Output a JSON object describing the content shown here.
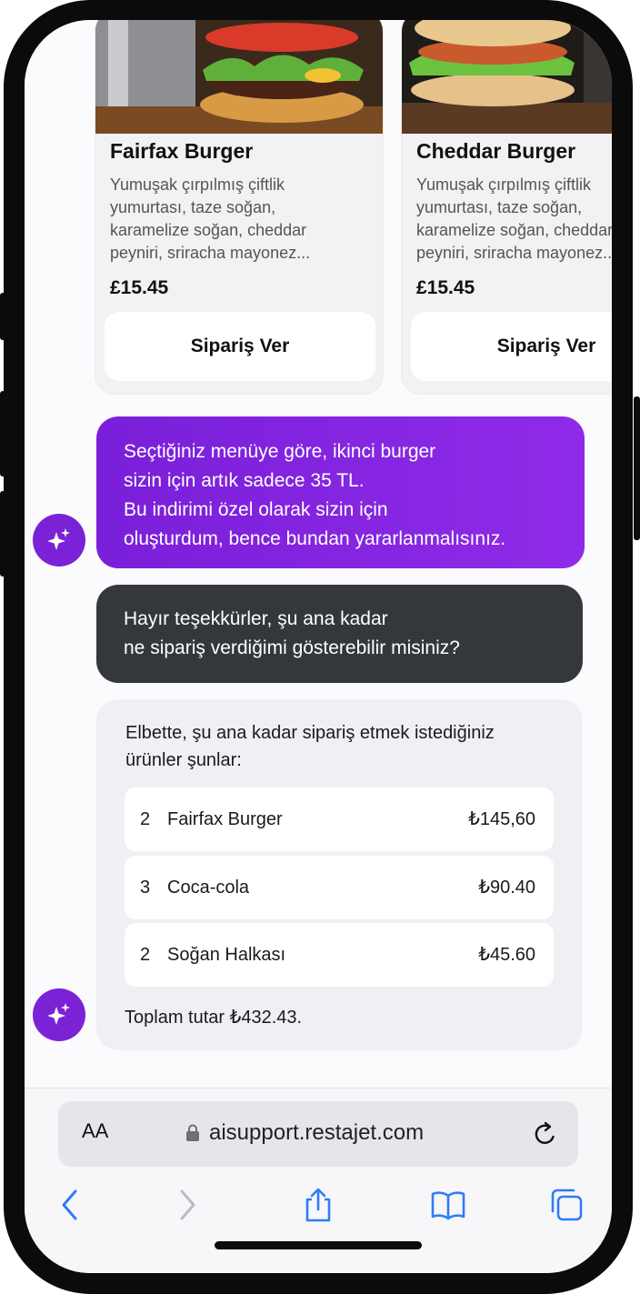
{
  "products": [
    {
      "title": "Fairfax Burger",
      "description": [
        "Yumuşak çırpılmış çiftlik",
        "yumurtası, taze soğan,",
        "karamelize soğan, cheddar",
        "peyniri, sriracha mayonez..."
      ],
      "price": "£15.45",
      "button_label": "Sipariş Ver"
    },
    {
      "title": "Cheddar Burger",
      "description": [
        "Yumuşak çırpılmış çiftlik",
        "yumurtası, taze soğan,",
        "karamelize soğan, cheddar",
        "peyniri, sriracha mayonez..."
      ],
      "price": "£15.45",
      "button_label": "Sipariş Ver"
    }
  ],
  "messages": {
    "bot_offer": [
      "Seçtiğiniz menüye göre, ikinci burger",
      "sizin için artık sadece 35 TL.",
      "Bu indirimi özel olarak sizin için",
      "oluşturdum, bence bundan yararlanmalısınız."
    ],
    "user_question": [
      "Hayır teşekkürler, şu ana kadar",
      "ne sipariş verdiğimi gösterebilir misiniz?"
    ],
    "bot_summary": {
      "intro": [
        "Elbette, şu ana kadar sipariş etmek istediğiniz",
        "ürünler şunlar:"
      ],
      "items": [
        {
          "qty": "2",
          "name": "Fairfax Burger",
          "price": "₺145,60"
        },
        {
          "qty": "3",
          "name": "Coca-cola",
          "price": "₺90.40"
        },
        {
          "qty": "2",
          "name": "Soğan Halkası",
          "price": "₺45.60"
        }
      ],
      "total": "Toplam tutar ₺432.43."
    }
  },
  "browser": {
    "text_size_label": "AA",
    "url": "aisupport.restajet.com",
    "icons": [
      "lock-icon",
      "reload-icon",
      "back-icon",
      "forward-icon",
      "share-icon",
      "bookmarks-icon",
      "tabs-icon"
    ]
  },
  "colors": {
    "accent_purple": "#7b22d6",
    "user_bubble": "#35383b",
    "link_blue": "#2f7cf6"
  }
}
